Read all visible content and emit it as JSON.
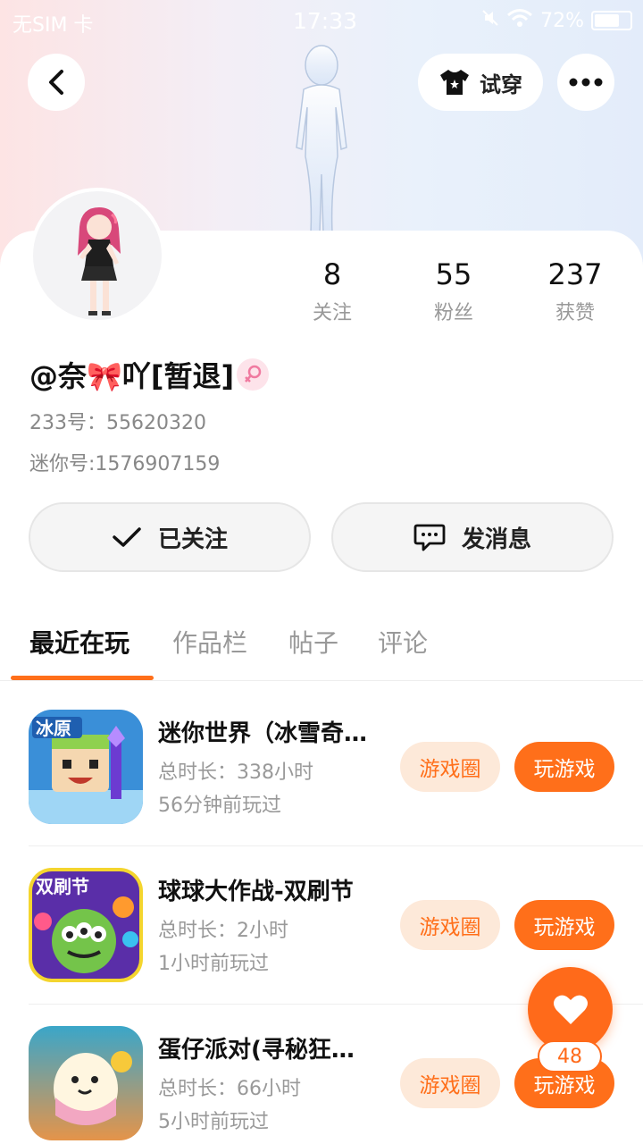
{
  "status_bar": {
    "carrier": "无SIM 卡",
    "time": "17:33",
    "battery": "72%"
  },
  "header": {
    "tryon_label": "试穿"
  },
  "profile": {
    "stats": [
      {
        "value": "8",
        "label": "关注"
      },
      {
        "value": "55",
        "label": "粉丝"
      },
      {
        "value": "237",
        "label": "获赞"
      }
    ],
    "name": "@奈🎀吖[暂退]",
    "id_233": "233号：55620320",
    "id_mini": "迷你号:1576907159",
    "follow_label": "已关注",
    "message_label": "发消息"
  },
  "tabs": [
    "最近在玩",
    "作品栏",
    "帖子",
    "评论"
  ],
  "games": [
    {
      "title": "迷你世界（冰雪奇…",
      "duration": "总时长：338小时",
      "last_played": "56分钟前玩过",
      "circle_label": "游戏圈",
      "play_label": "玩游戏",
      "icon_badge": "冰原"
    },
    {
      "title": "球球大作战-双刷节",
      "duration": "总时长：2小时",
      "last_played": "1小时前玩过",
      "circle_label": "游戏圈",
      "play_label": "玩游戏",
      "icon_badge": "双刷节"
    },
    {
      "title": "蛋仔派对(寻秘狂…",
      "duration": "总时长：66小时",
      "last_played": "5小时前玩过",
      "circle_label": "游戏圈",
      "play_label": "玩游戏",
      "icon_badge": ""
    }
  ],
  "like_count": "48",
  "colors": {
    "accent": "#ff6f1a",
    "accent_soft": "#fde9d9"
  }
}
